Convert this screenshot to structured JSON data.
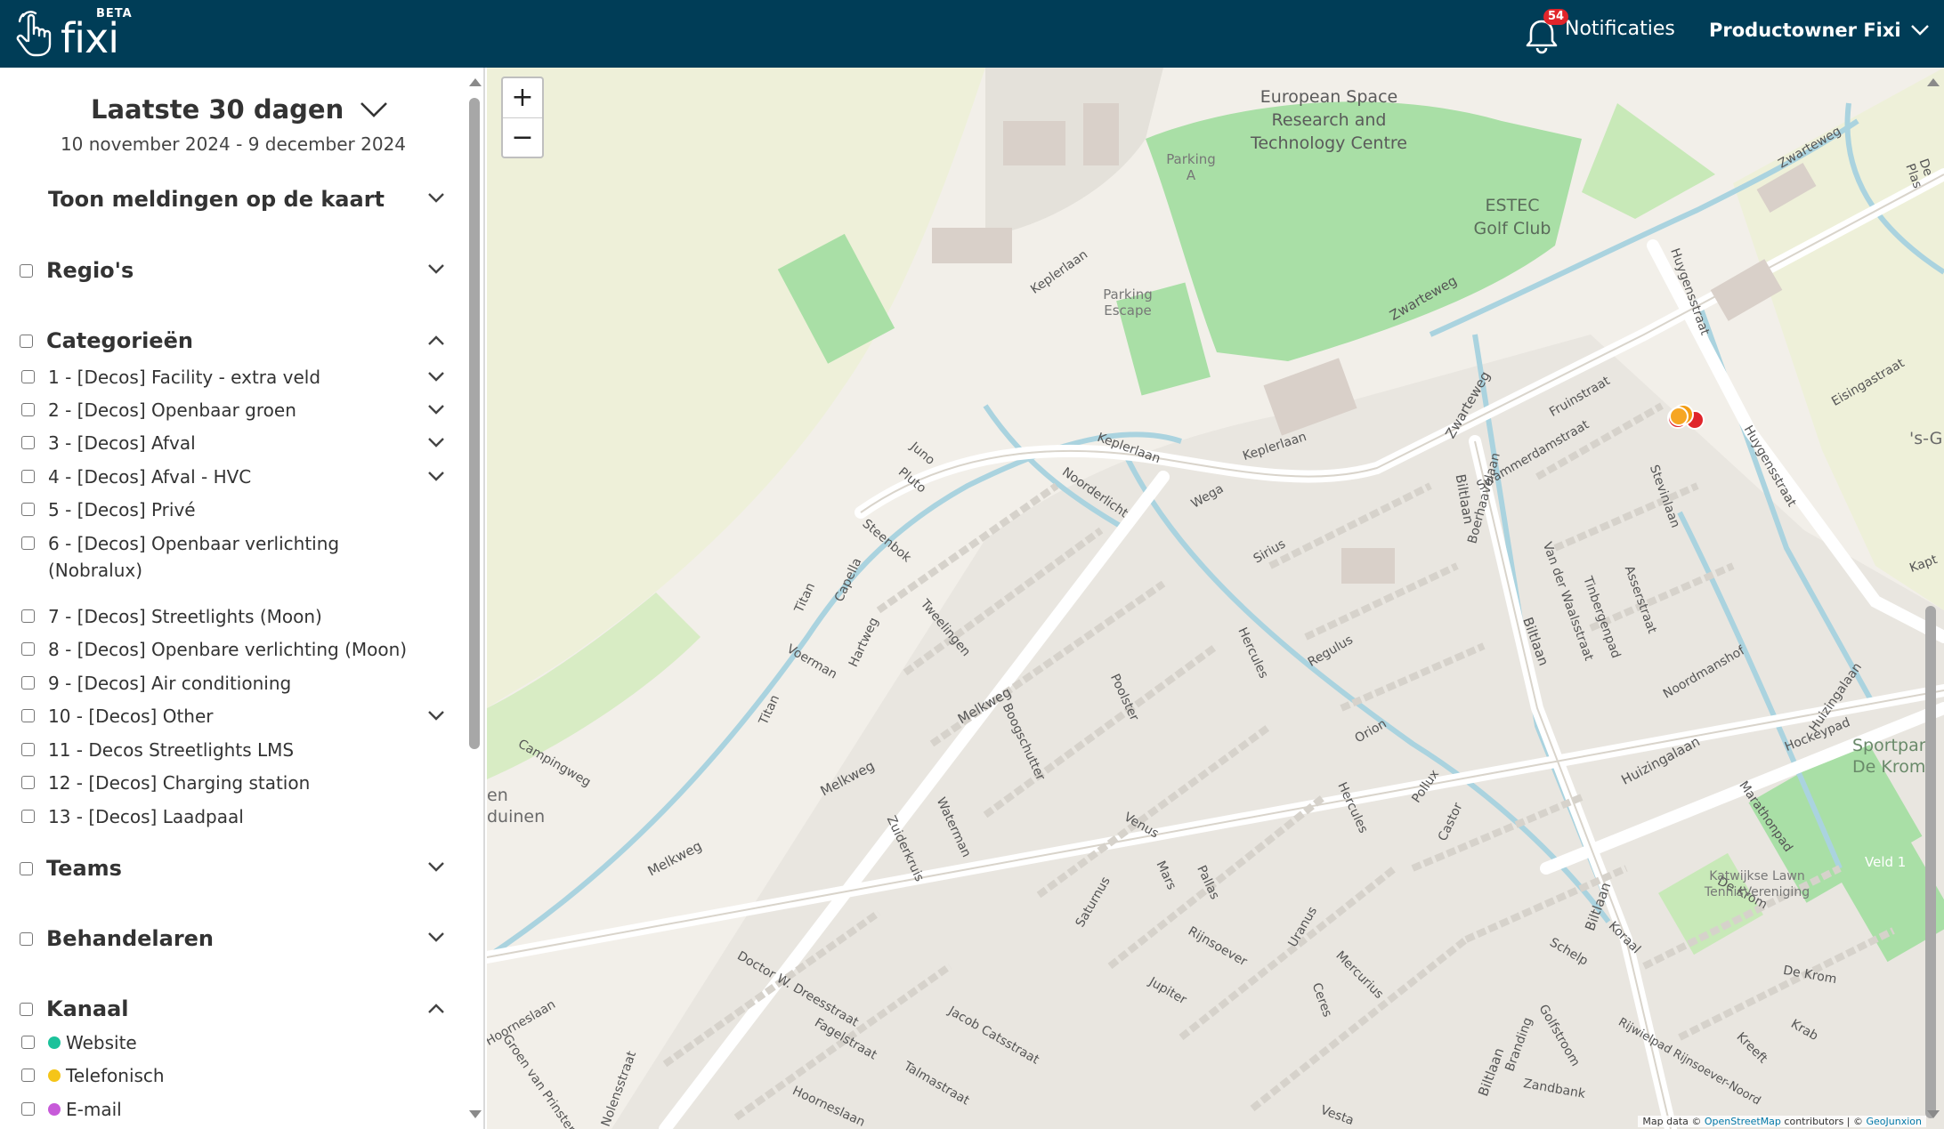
{
  "brand": {
    "name": "fixi",
    "badge": "BETA"
  },
  "header": {
    "notifications_label": "Notificaties",
    "notifications_count": "54",
    "user_name": "Productowner Fixi"
  },
  "sidebar": {
    "period_title": "Laatste 30 dagen",
    "period_range": "10 november 2024 - 9 december 2024",
    "show_on_map": "Toon meldingen op de kaart",
    "regions": "Regio's",
    "categories_title": "Categorieën",
    "categories": [
      "1 - [Decos] Facility - extra veld",
      "2 - [Decos] Openbaar groen",
      "3 - [Decos] Afval",
      "4 - [Decos] Afval - HVC",
      "5 - [Decos] Privé",
      "6 - [Decos] Openbaar verlichting (Nobralux)",
      "7 - [Decos] Streetlights (Moon)",
      "8 - [Decos] Openbare verlichting (Moon)",
      "9 - [Decos] Air conditioning",
      "10 - [Decos] Other",
      "11 - Decos Streetlights LMS",
      "12 - [Decos] Charging station",
      "13 - [Decos] Laadpaal"
    ],
    "teams": "Teams",
    "handlers": "Behandelaren",
    "channel_title": "Kanaal",
    "channels": [
      {
        "label": "Website",
        "color": "#1cc29b"
      },
      {
        "label": "Telefonisch",
        "color": "#f5c518"
      },
      {
        "label": "E-mail",
        "color": "#c75ad9"
      }
    ]
  },
  "map": {
    "zoom_in": "+",
    "zoom_out": "−",
    "attribution_prefix": "Map data ©",
    "attribution_osm": "OpenStreetMap",
    "attribution_mid": "contributors | ©",
    "attribution_geo": "GeoJunxion",
    "labels": {
      "esrtc": "European Space Research and Technology Centre",
      "golf": "ESTEC Golf Club",
      "parking_a": "Parking A",
      "parking_escape": "Parking Escape",
      "keplerlaan": "Keplerlaan",
      "zwarteweg": "Zwarteweg",
      "huygensstraat": "Huygensstraat",
      "eisingastraat": "Eisingastraat",
      "biltlaan": "Biltlaan",
      "melkweg": "Melkweg",
      "huizingalaan": "Huizingalaan",
      "de_krom": "De Krom",
      "sportpark": "Sportpark De Krom",
      "veld": "Veld 1",
      "tennis": "Katwijkse Lawn TennisVereniging",
      "hockeypad": "Hockeypad",
      "marathonpad": "Marathonpad",
      "noordmanshof": "Noordmanshof",
      "steenbok": "Steenbok",
      "pluto": "Pluto",
      "juno": "Juno",
      "noorderlicht": "Noorderlicht",
      "wega": "Wega",
      "sirius": "Sirius",
      "regulus": "Regulus",
      "orion": "Orion",
      "hercules": "Hercules",
      "pollux": "Pollux",
      "castor": "Castor",
      "venus": "Venus",
      "mars": "Mars",
      "pallas": "Pallas",
      "saturnus": "Saturnus",
      "uranus": "Uranus",
      "jupiter": "Jupiter",
      "mercurius": "Mercurius",
      "ceres": "Ceres",
      "rijnsoever": "Rijnsoever",
      "vesta": "Vesta",
      "zandbank": "Zandbank",
      "branding": "Branding",
      "golfstroom": "Golfstroom",
      "schelp": "Schelp",
      "koraal": "Koraal",
      "krab": "Krab",
      "kreeft": "Kreeft",
      "tweelingen": "Tweelingen",
      "hartweg": "Hartweg",
      "capella": "Capella",
      "titan": "Titan",
      "voerman": "Voerman",
      "boogschutter": "Boogschutter",
      "poolster": "Poolster",
      "waterman": "Waterman",
      "zuiderkruis": "Zuiderkruis",
      "dresstraat": "Doctor W. Dreesstraat",
      "jacobcats": "Jacob Catsstraat",
      "talmastraat": "Talmastraat",
      "fagelstraat": "Fagelstraat",
      "hoorneslaan": "Hoorneslaan",
      "campingweg": "Campingweg",
      "nolensstraat": "Nolensstraat",
      "groen": "Groen van Prinsterer",
      "fruinstraat": "Fruinstraat",
      "swammerdam": "Swammerdamstraat",
      "boerhaave": "Boerhaavelaan",
      "vdwaals": "Van der Waalsstraat",
      "tinbergen": "Tinbergenpad",
      "asserstraat": "Asserstraat",
      "stevinlaan": "Stevinlaan",
      "rijwielpad": "Rijwielpad Rijnsoever-Noord",
      "de_plas": "De Plas",
      "duinen": "en duinen",
      "sg": "'s-G",
      "kap": "Kapt"
    }
  }
}
